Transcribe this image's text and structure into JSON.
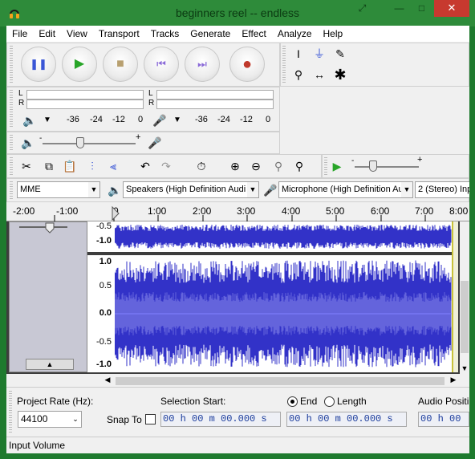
{
  "window": {
    "title": "beginners reel -- endless",
    "close_glyph": "✕",
    "min_glyph": "—",
    "restore_glyph": "⤢"
  },
  "menu": [
    "File",
    "Edit",
    "View",
    "Transport",
    "Tracks",
    "Generate",
    "Effect",
    "Analyze",
    "Help"
  ],
  "transport": {
    "pause": "❚❚",
    "play": "▶",
    "stop": "■",
    "skip_start": "⏮",
    "skip_end": "⏭",
    "record": "●"
  },
  "tools": {
    "select": "I",
    "envelope": "⏚",
    "draw": "✎",
    "zoom": "⚲",
    "timeshift": "↔",
    "multi": "✱"
  },
  "meters": {
    "play_scale": [
      "-36",
      "-24",
      "-12",
      "0"
    ],
    "rec_scale": [
      "-36",
      "-24",
      "-12",
      "0"
    ],
    "channels": [
      "L",
      "R"
    ]
  },
  "mixer": {
    "plus": "+",
    "minus": "-"
  },
  "device": {
    "host": "MME",
    "output": "Speakers (High Definition Audi",
    "input": "Microphone (High Definition Au",
    "channels": "2 (Stereo) Inp"
  },
  "ruler": [
    "-2:00",
    "-1:00",
    "0",
    "1:00",
    "2:00",
    "3:00",
    "4:00",
    "5:00",
    "6:00",
    "7:00",
    "8:00"
  ],
  "track": {
    "upper_scale": [
      "-0.5",
      "-1.0"
    ],
    "lower_scale": [
      "1.0",
      "0.5",
      "0.0",
      "-0.5",
      "-1.0"
    ]
  },
  "selection": {
    "project_rate_label": "Project Rate (Hz):",
    "project_rate": "44100",
    "snap_to": "Snap To",
    "selection_start_label": "Selection Start:",
    "end_label": "End",
    "length_label": "Length",
    "start_time": "00 h 00 m 00.000 s",
    "end_time": "00 h 00 m 00.000 s",
    "audio_position_label": "Audio Positi",
    "audio_position": "00 h 00"
  },
  "status": {
    "text": "Input Volume"
  },
  "colors": {
    "title_bar": "#2e8b3a",
    "wave": "#3232c8",
    "wave_light": "#6464dc",
    "record": "#c0392b"
  }
}
